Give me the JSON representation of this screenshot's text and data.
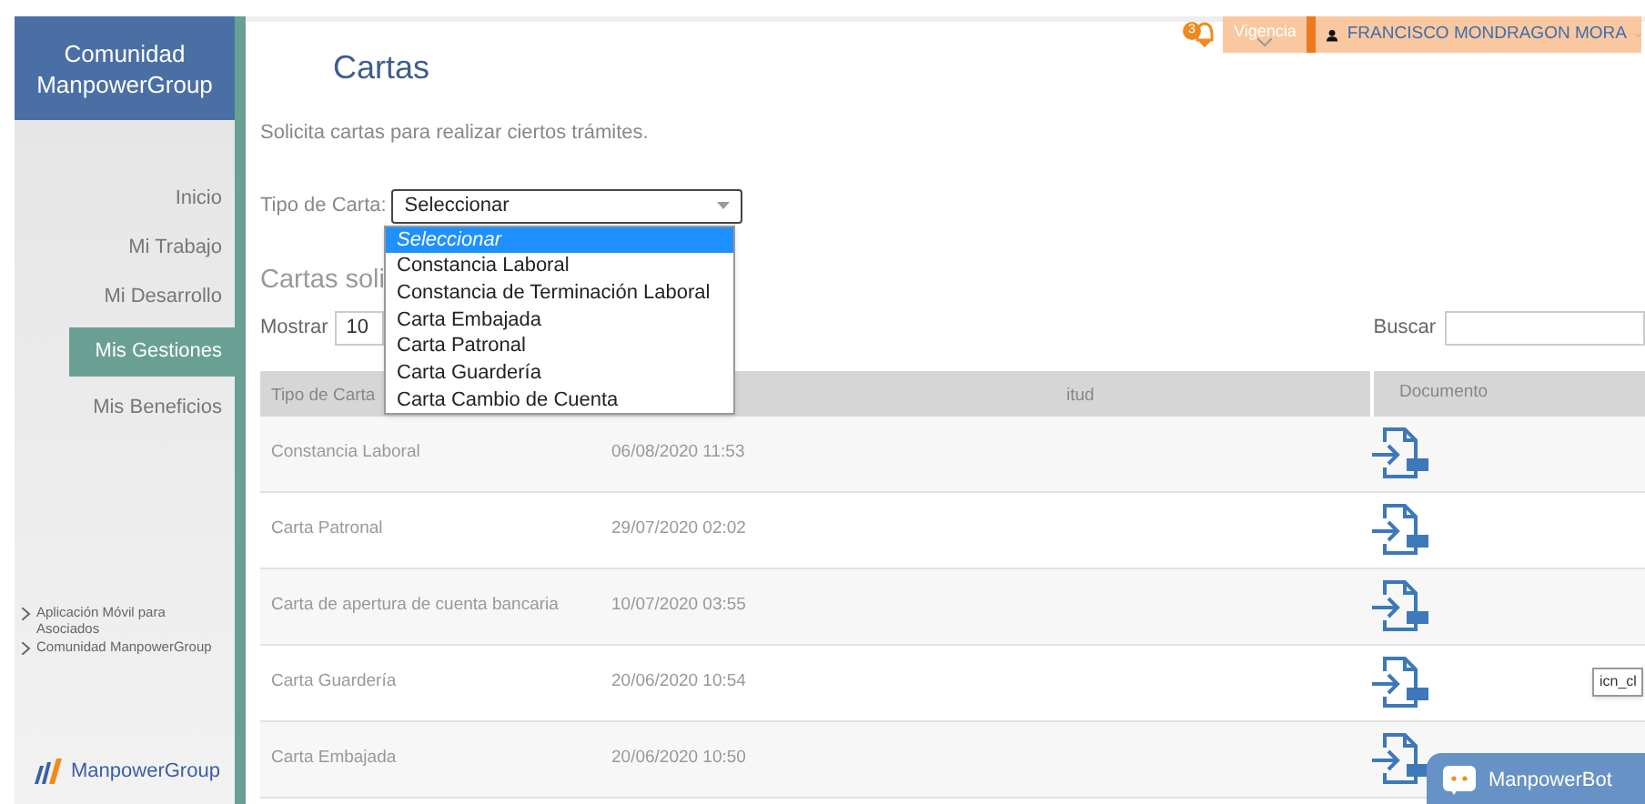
{
  "sidebar": {
    "title": "Comunidad ManpowerGroup",
    "items": [
      {
        "label": "Inicio",
        "selected": false
      },
      {
        "label": "Mi Trabajo",
        "selected": false
      },
      {
        "label": "Mi Desarrollo",
        "selected": false
      },
      {
        "label": "Mis Gestiones",
        "selected": true
      },
      {
        "label": "Mis Beneficios",
        "selected": false
      }
    ],
    "links": [
      "Aplicación Móvil para Asociados",
      "Comunidad ManpowerGroup"
    ],
    "logo_text": "ManpowerGroup"
  },
  "header": {
    "notification_count": "3",
    "notice": "Vigencia",
    "user_name": "FRANCISCO MONDRAGON MORA"
  },
  "page": {
    "title": "Cartas",
    "subtitle": "Solicita cartas para realizar ciertos trámites.",
    "type_label": "Tipo de Carta:",
    "type_select": {
      "value": "Seleccionar",
      "expanded": true,
      "options": [
        {
          "label": "Seleccionar",
          "selected": true
        },
        {
          "label": "Constancia Laboral",
          "selected": false
        },
        {
          "label": "Constancia de Terminación Laboral",
          "selected": false
        },
        {
          "label": "Carta Embajada",
          "selected": false
        },
        {
          "label": "Carta Patronal",
          "selected": false
        },
        {
          "label": "Carta Guardería",
          "selected": false
        },
        {
          "label": "Carta Cambio de Cuenta",
          "selected": false
        }
      ]
    },
    "section_title": "Cartas soli",
    "show_label": "Mostrar",
    "show_value": "10",
    "search_label": "Buscar"
  },
  "table": {
    "columns": [
      "Tipo de Carta",
      "itud",
      "Documento"
    ],
    "rows": [
      {
        "type": "Constancia Laboral",
        "date": "06/08/2020 11:53"
      },
      {
        "type": "Carta Patronal",
        "date": "29/07/2020 02:02"
      },
      {
        "type": "Carta de apertura de cuenta bancaria",
        "date": "10/07/2020 03:55"
      },
      {
        "type": "Carta Guardería",
        "date": "20/06/2020 10:54"
      },
      {
        "type": "Carta Embajada",
        "date": "20/06/2020 10:50"
      }
    ]
  },
  "tooltip": "icn_cl",
  "chat_button": "ManpowerBot"
}
